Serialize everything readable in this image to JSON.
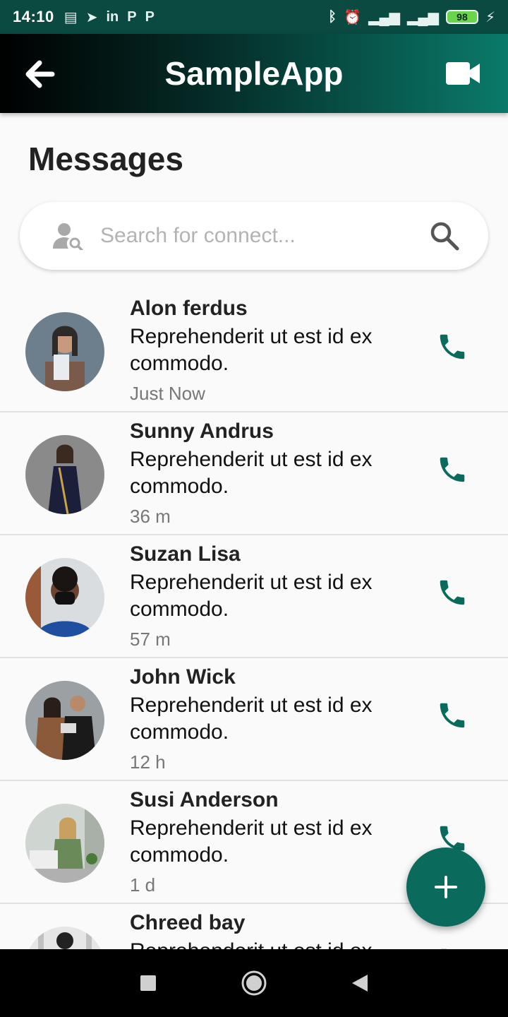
{
  "status_bar": {
    "time": "14:10",
    "left_icons": [
      "message-icon",
      "telegram-icon",
      "linkedin-icon",
      "p-icon",
      "p-icon"
    ],
    "left_icon_glyphs": [
      "▤",
      "➤",
      "in",
      "P",
      "P"
    ],
    "right_icons": [
      "bluetooth-icon",
      "alarm-off-icon",
      "signal-4g-icon",
      "signal-icon",
      "battery-icon"
    ],
    "right_icon_glyphs": [
      "ᛒ",
      "⏰",
      "▂▄▆",
      "▂▄▆",
      ""
    ],
    "battery": "98"
  },
  "app_bar": {
    "title": "SampleApp",
    "back_icon": "back-arrow-icon",
    "video_icon": "video-camera-icon",
    "gradient": [
      "#000000",
      "#0a7a6a"
    ]
  },
  "page": {
    "title": "Messages"
  },
  "search": {
    "placeholder": "Search for connect...",
    "value": "",
    "left_icon": "person-search-icon",
    "right_icon": "search-icon"
  },
  "messages": [
    {
      "name": "Alon ferdus",
      "text": "Reprehenderit ut est id ex commodo.",
      "time": "Just Now",
      "avatar_colors": [
        "#6d7f8c",
        "#2f2a2a"
      ]
    },
    {
      "name": "Sunny Andrus",
      "text": "Reprehenderit ut est id ex commodo.",
      "time": "36 m",
      "avatar_colors": [
        "#8a8a8a",
        "#1c1f3a"
      ]
    },
    {
      "name": "Suzan Lisa",
      "text": "Reprehenderit ut est id ex commodo.",
      "time": "57 m",
      "avatar_colors": [
        "#d9dde0",
        "#1f4fa0"
      ]
    },
    {
      "name": "John Wick",
      "text": "Reprehenderit ut est id ex commodo.",
      "time": "12 h",
      "avatar_colors": [
        "#9aa0a3",
        "#1a1a1a"
      ]
    },
    {
      "name": "Susi Anderson",
      "text": "Reprehenderit ut est id ex commodo.",
      "time": "1 d",
      "avatar_colors": [
        "#cfd6d1",
        "#6a8a5a"
      ]
    },
    {
      "name": "Chreed bay",
      "text": "Reprehenderit ut est id ex commodo.",
      "time": "",
      "avatar_colors": [
        "#e6e6e6",
        "#222222"
      ]
    }
  ],
  "fab": {
    "icon": "plus-icon"
  },
  "nav_bar": {
    "icons": [
      "recents-square-icon",
      "home-circle-icon",
      "back-triangle-icon"
    ]
  },
  "colors": {
    "accent": "#0a6b5d",
    "status_bar": "#0a4a40",
    "call_icon": "#0a6b5d"
  }
}
